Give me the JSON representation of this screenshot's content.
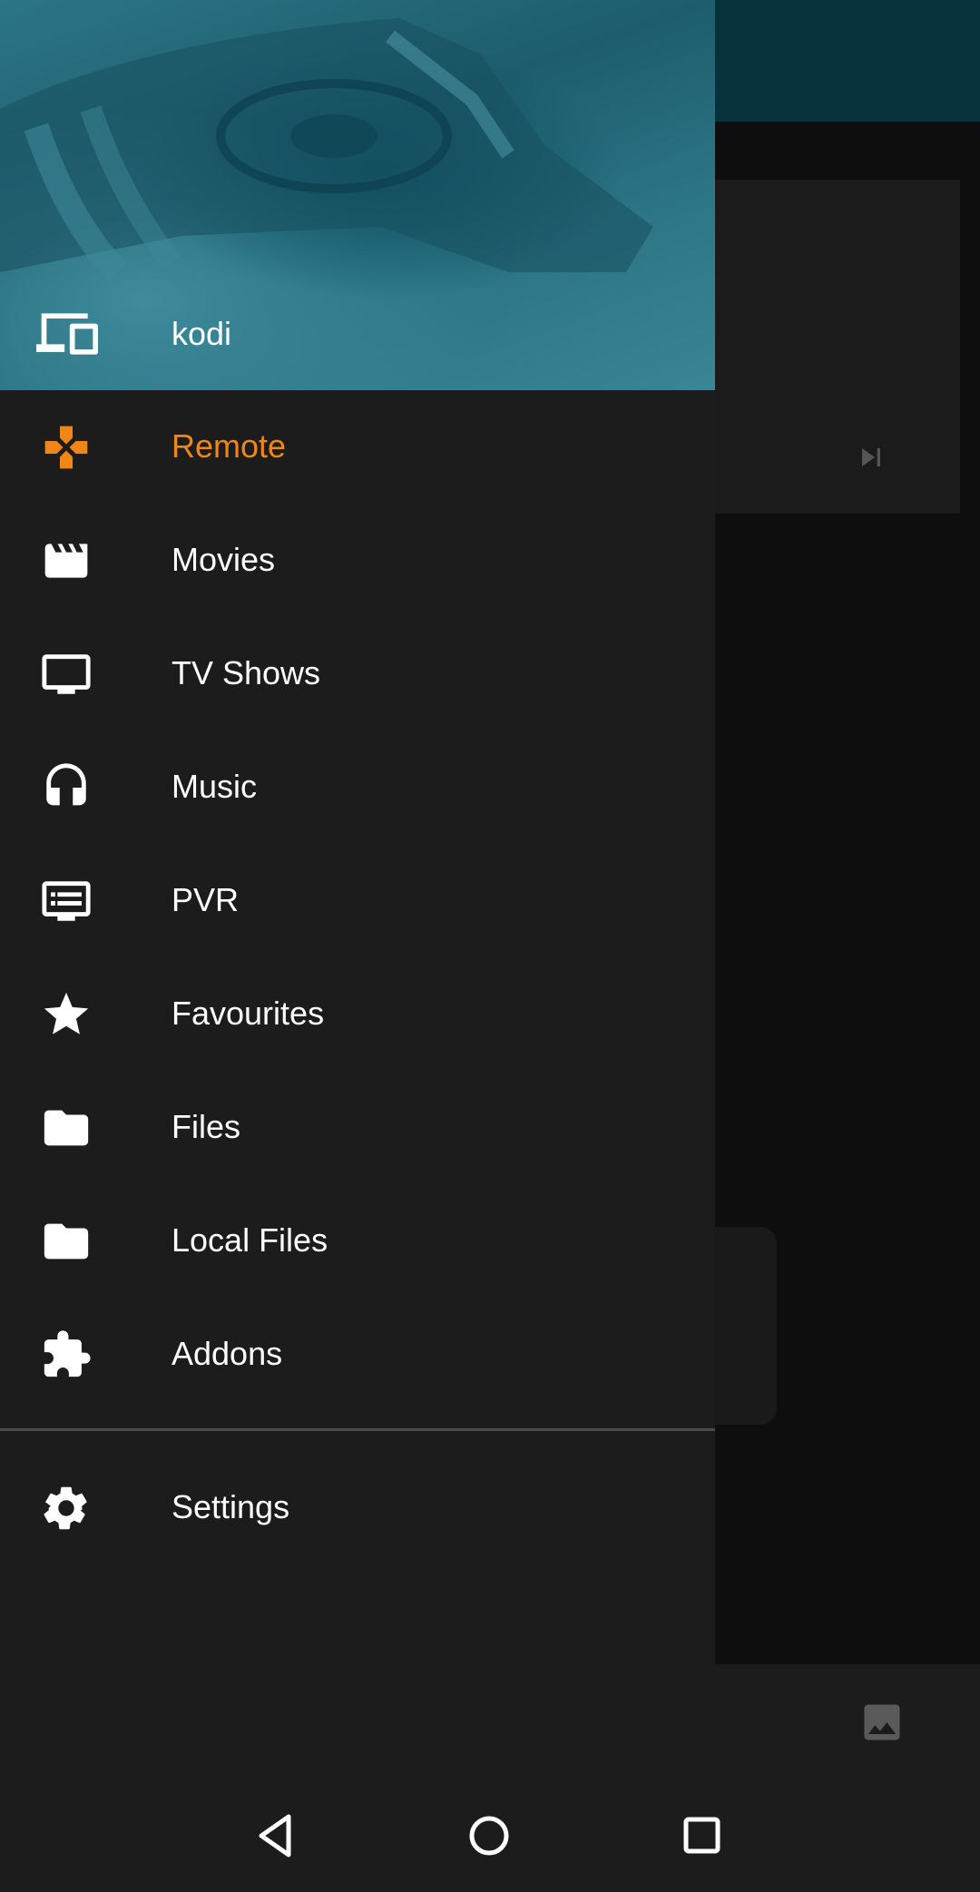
{
  "colors": {
    "accent": "#f08518",
    "drawer_bg": "#1c1c1c",
    "header_teal": "#2c7585",
    "topbar": "#06313d",
    "text": "#ffffff"
  },
  "header": {
    "host_name": "kodi",
    "host_icon": "devices-icon"
  },
  "nav": {
    "items": [
      {
        "label": "Remote",
        "icon": "gamepad-icon",
        "active": true
      },
      {
        "label": "Movies",
        "icon": "movie-clapper-icon",
        "active": false
      },
      {
        "label": "TV Shows",
        "icon": "tv-icon",
        "active": false
      },
      {
        "label": "Music",
        "icon": "headphones-icon",
        "active": false
      },
      {
        "label": "PVR",
        "icon": "tv-guide-icon",
        "active": false
      },
      {
        "label": "Favourites",
        "icon": "star-icon",
        "active": false
      },
      {
        "label": "Files",
        "icon": "folder-icon",
        "active": false
      },
      {
        "label": "Local Files",
        "icon": "folder-icon",
        "active": false
      },
      {
        "label": "Addons",
        "icon": "puzzle-icon",
        "active": false
      }
    ],
    "settings": {
      "label": "Settings",
      "icon": "gear-icon"
    }
  },
  "system_nav": {
    "back": "back-icon",
    "home": "home-icon",
    "recents": "recents-icon"
  }
}
